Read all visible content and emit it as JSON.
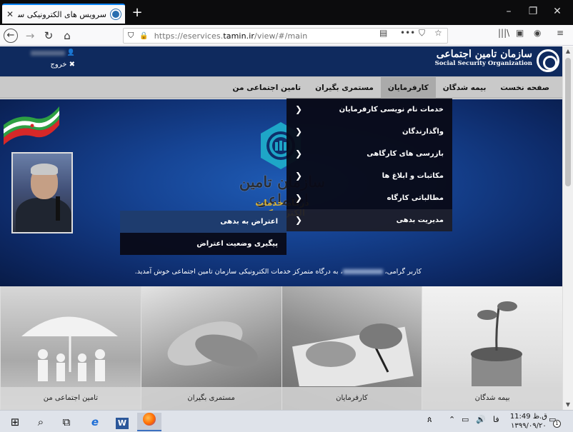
{
  "browser": {
    "tab_title": "سرویس های الکترونیکی سازمان تا",
    "tab_close": "✕",
    "new_tab": "+",
    "url_prefix": "https://eservices.",
    "url_domain": "tamin.ir",
    "url_path": "/view/#/main",
    "window_controls": {
      "minimize": "–",
      "maximize": "❐",
      "close": "✕"
    }
  },
  "site_header": {
    "logo_fa": "سازمان تامین اجتماعی",
    "logo_en": "Social Security Organization",
    "user_icon": "user-icon",
    "logout_label": "خروج"
  },
  "main_menu": {
    "items": [
      {
        "label": "صفحه نخست"
      },
      {
        "label": "بیمه شدگان"
      },
      {
        "label": "کارفرمایان"
      },
      {
        "label": "مستمری بگیران"
      },
      {
        "label": "تامین اجتماعی من"
      }
    ],
    "active": "کارفرمایان"
  },
  "dropdown": {
    "items": [
      {
        "label": "خدمات نام نویسی کارفرمایان"
      },
      {
        "label": "واگذارندگان"
      },
      {
        "label": "بازرسی های کارگاهی"
      },
      {
        "label": "مکاتبات و ابلاغ ها"
      },
      {
        "label": "مطالباتی کارگاه"
      },
      {
        "label": "مدیریت بدهی"
      }
    ]
  },
  "sub_dropdown": {
    "items": [
      {
        "label": "اعتراض به بدهی"
      },
      {
        "label": "پیگیری وضعیت اعتراض"
      }
    ]
  },
  "banner": {
    "title": "سازمان تامین اجتماعی",
    "subtitle": "درگاه خدمات الکترونیکی",
    "welcome_prefix": "کاربر گرامی، ",
    "welcome_suffix": "، به درگاه متمرکز خدمات الکترونیکی سازمان تامین اجتماعی خوش آمدید."
  },
  "tiles": [
    {
      "caption": "بیمه شدگان"
    },
    {
      "caption": "کارفرمایان"
    },
    {
      "caption": "مستمری بگیران"
    },
    {
      "caption": "تامین اجتماعی من"
    }
  ],
  "taskbar": {
    "language": "فا",
    "time": "11:49 ق.ظ",
    "date": "۱۳۹۹/۰۹/۲۰",
    "notification_count": "1"
  },
  "colors": {
    "header_bg": "#0f2a5e",
    "menu_bg": "#c9c9c9",
    "dropdown_bg": "#080a16",
    "accent_gold": "#d6b23a",
    "browser_accent": "#0a84ff"
  }
}
